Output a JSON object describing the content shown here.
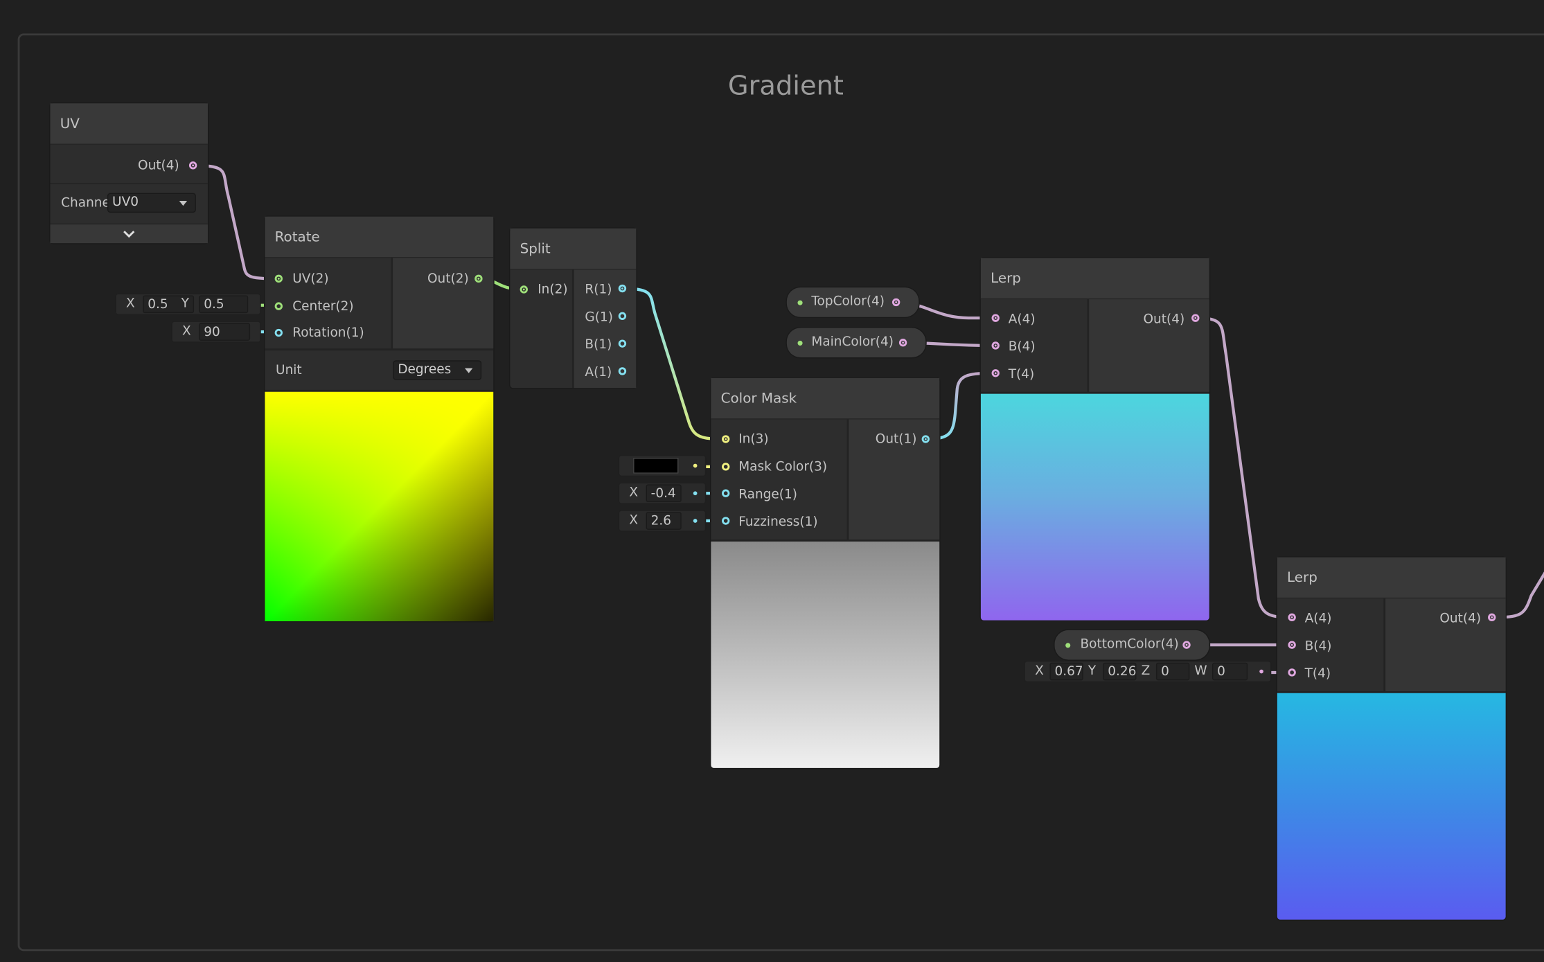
{
  "group": {
    "title": "Gradient"
  },
  "colors": {
    "background": "#202020",
    "vector4_port": "#e0a8e0",
    "vector3_port": "#f0f080",
    "vector2_port": "#9fe07a",
    "vector1_port": "#84e0f0",
    "boolean_port": "#9fe07a"
  },
  "uv_node": {
    "title": "UV",
    "out_label": "Out(4)",
    "channel_label": "Channe",
    "channel_value": "UV0",
    "expand_icon": "chevron-down-icon"
  },
  "rotate_node": {
    "title": "Rotate",
    "inputs": [
      "UV(2)",
      "Center(2)",
      "Rotation(1)"
    ],
    "output": "Out(2)",
    "unit_label": "Unit",
    "unit_value": "Degrees",
    "center_default": {
      "x_label": "X",
      "x": "0.5",
      "y_label": "Y",
      "y": "0.5"
    },
    "rotation_default": {
      "x_label": "X",
      "x": "90"
    }
  },
  "split_node": {
    "title": "Split",
    "input": "In(2)",
    "outputs": [
      "R(1)",
      "G(1)",
      "B(1)",
      "A(1)"
    ]
  },
  "color_mask_node": {
    "title": "Color Mask",
    "inputs": [
      "In(3)",
      "Mask Color(3)",
      "Range(1)",
      "Fuzziness(1)"
    ],
    "output": "Out(1)",
    "mask_color": "#000000",
    "range_default": {
      "x_label": "X",
      "x": "-0.4"
    },
    "fuzziness_default": {
      "x_label": "X",
      "x": "2.6"
    }
  },
  "properties": {
    "top_color": "TopColor(4)",
    "main_color": "MainColor(4)",
    "bottom_color": "BottomColor(4)"
  },
  "lerp_node_1": {
    "title": "Lerp",
    "inputs": [
      "A(4)",
      "B(4)",
      "T(4)"
    ],
    "output": "Out(4)"
  },
  "lerp_node_2": {
    "title": "Lerp",
    "inputs": [
      "A(4)",
      "B(4)",
      "T(4)"
    ],
    "output": "Out(4)",
    "t_default": {
      "x_label": "X",
      "x": "0.67",
      "y_label": "Y",
      "y": "0.26",
      "z_label": "Z",
      "z": "0",
      "w_label": "W",
      "w": "0"
    }
  }
}
